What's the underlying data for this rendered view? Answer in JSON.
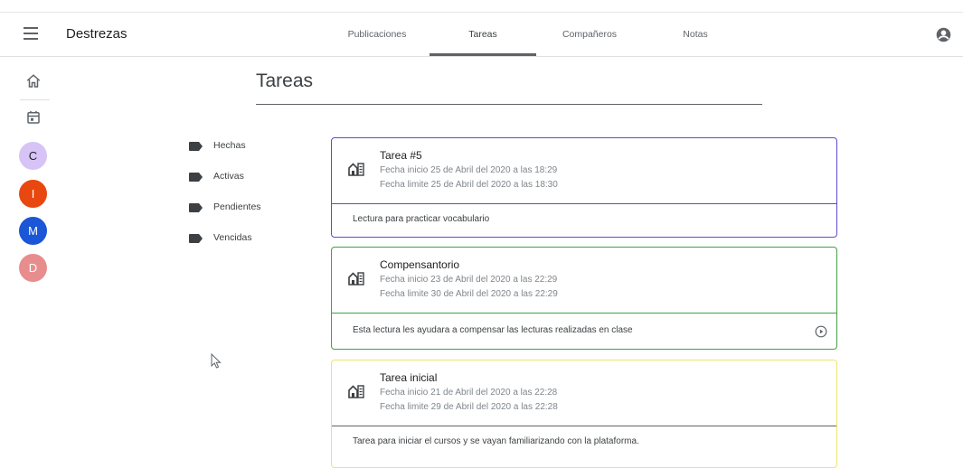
{
  "header": {
    "app_title": "Destrezas",
    "tabs": [
      {
        "label": "Publicaciones"
      },
      {
        "label": "Tareas"
      },
      {
        "label": "Compañeros"
      },
      {
        "label": "Notas"
      }
    ],
    "active_tab": "Tareas"
  },
  "sidebar": {
    "items": [
      {
        "icon": "home-icon"
      },
      {
        "icon": "calendar-icon"
      }
    ],
    "avatars": [
      {
        "letter": "C",
        "color": "#d7c3f6"
      },
      {
        "letter": "I",
        "color": "#e8470f"
      },
      {
        "letter": "M",
        "color": "#1a56d6"
      },
      {
        "letter": "D",
        "color": "#e88d8d"
      }
    ]
  },
  "page": {
    "title": "Tareas"
  },
  "filters": [
    {
      "label": "Hechas",
      "icon": "label-icon"
    },
    {
      "label": "Activas",
      "icon": "label-icon"
    },
    {
      "label": "Pendientes",
      "icon": "label-icon"
    },
    {
      "label": "Vencidas",
      "icon": "label-icon"
    }
  ],
  "tasks": [
    {
      "title": "Tarea #5",
      "start": "Fecha inicio 25 de Abril del 2020 a las 18:29",
      "end": "Fecha limite 25 de Abril del 2020 a las 18:30",
      "description": "Lectura para practicar vocabulario",
      "color": "#5b4ccf",
      "icon": "assignment-icon"
    },
    {
      "title": "Compensantorio",
      "start": "Fecha inicio 23 de Abril del 2020 a las 22:29",
      "end": "Fecha limite 30 de Abril del 2020 a las 22:29",
      "description": "Esta lectura les ayudara a compensar las lecturas realizadas en clase",
      "color": "#43a047",
      "icon": "assignment-icon",
      "action_icon": "play-circle-icon"
    },
    {
      "title": "Tarea inicial",
      "start": "Fecha inicio 21 de Abril del 2020 a las 22:28",
      "end": "Fecha limite 29 de Abril del 2020 a las 22:28",
      "description": "Tarea para iniciar el cursos y se vayan familiarizando con la plataforma.",
      "color": "#f2e36b",
      "icon": "assignment-icon"
    }
  ],
  "colors": {
    "accent": "#5f6368",
    "label_tag": "#3c4043"
  }
}
